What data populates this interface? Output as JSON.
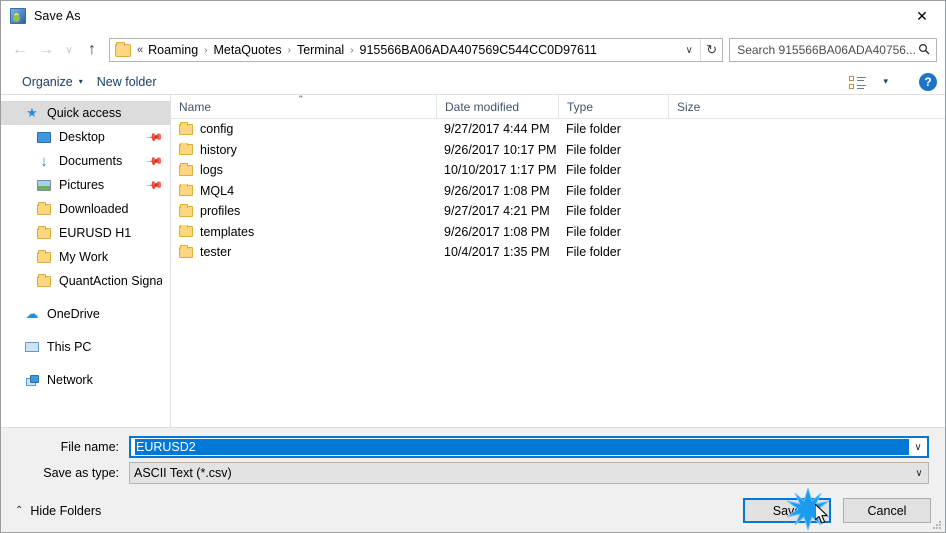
{
  "window": {
    "title": "Save As",
    "icon": "app-icon",
    "close_label": "✕"
  },
  "nav": {
    "back": "←",
    "forward": "→",
    "recent": "∨",
    "up": "↑",
    "breadcrumb_prefix": "«",
    "crumbs": [
      "Roaming",
      "MetaQuotes",
      "Terminal",
      "915566BA06ADA407569C544CC0D97611"
    ],
    "separator": "›",
    "dropdown": "∨",
    "refresh": "↻"
  },
  "search": {
    "placeholder": "Search 915566BA06ADA40756...",
    "icon": "search-icon"
  },
  "toolbar": {
    "organize_label": "Organize",
    "organize_caret": "▾",
    "new_folder_label": "New folder",
    "view_caret": "▾",
    "help_label": "?"
  },
  "sidebar": {
    "quick_access": {
      "label": "Quick access",
      "icon": "star-icon",
      "selected": true
    },
    "items": [
      {
        "label": "Desktop",
        "icon": "desktop-icon",
        "pinned": true
      },
      {
        "label": "Documents",
        "icon": "download-icon",
        "pinned": true
      },
      {
        "label": "Pictures",
        "icon": "pictures-icon",
        "pinned": true
      },
      {
        "label": "Downloaded",
        "icon": "folder-icon",
        "pinned": false
      },
      {
        "label": "EURUSD H1",
        "icon": "folder-icon",
        "pinned": false
      },
      {
        "label": "My Work",
        "icon": "folder-icon",
        "pinned": false
      },
      {
        "label": "QuantAction Signal",
        "icon": "folder-icon",
        "pinned": false
      }
    ],
    "roots": [
      {
        "label": "OneDrive",
        "icon": "cloud-icon"
      },
      {
        "label": "This PC",
        "icon": "pc-icon"
      },
      {
        "label": "Network",
        "icon": "network-icon"
      }
    ]
  },
  "filelist": {
    "columns": [
      "Name",
      "Date modified",
      "Type",
      "Size"
    ],
    "sort_indicator": "⌃",
    "rows": [
      {
        "name": "config",
        "date": "9/27/2017 4:44 PM",
        "type": "File folder",
        "size": ""
      },
      {
        "name": "history",
        "date": "9/26/2017 10:17 PM",
        "type": "File folder",
        "size": ""
      },
      {
        "name": "logs",
        "date": "10/10/2017 1:17 PM",
        "type": "File folder",
        "size": ""
      },
      {
        "name": "MQL4",
        "date": "9/26/2017 1:08 PM",
        "type": "File folder",
        "size": ""
      },
      {
        "name": "profiles",
        "date": "9/27/2017 4:21 PM",
        "type": "File folder",
        "size": ""
      },
      {
        "name": "templates",
        "date": "9/26/2017 1:08 PM",
        "type": "File folder",
        "size": ""
      },
      {
        "name": "tester",
        "date": "10/4/2017 1:35 PM",
        "type": "File folder",
        "size": ""
      }
    ]
  },
  "form": {
    "filename_label": "File name:",
    "filename_value": "EURUSD2",
    "filetype_label": "Save as type:",
    "filetype_value": "ASCII Text (*.csv)",
    "dropdown_arrow": "∨"
  },
  "footer": {
    "hide_folders_label": "Hide Folders",
    "hide_folders_caret": "⌃",
    "save_label": "Save",
    "cancel_label": "Cancel"
  },
  "colors": {
    "accent": "#0078d7",
    "folder": "#fcd77f",
    "selection": "#0078d7",
    "link": "#1c3f66",
    "burst": "#1a9bf0"
  }
}
